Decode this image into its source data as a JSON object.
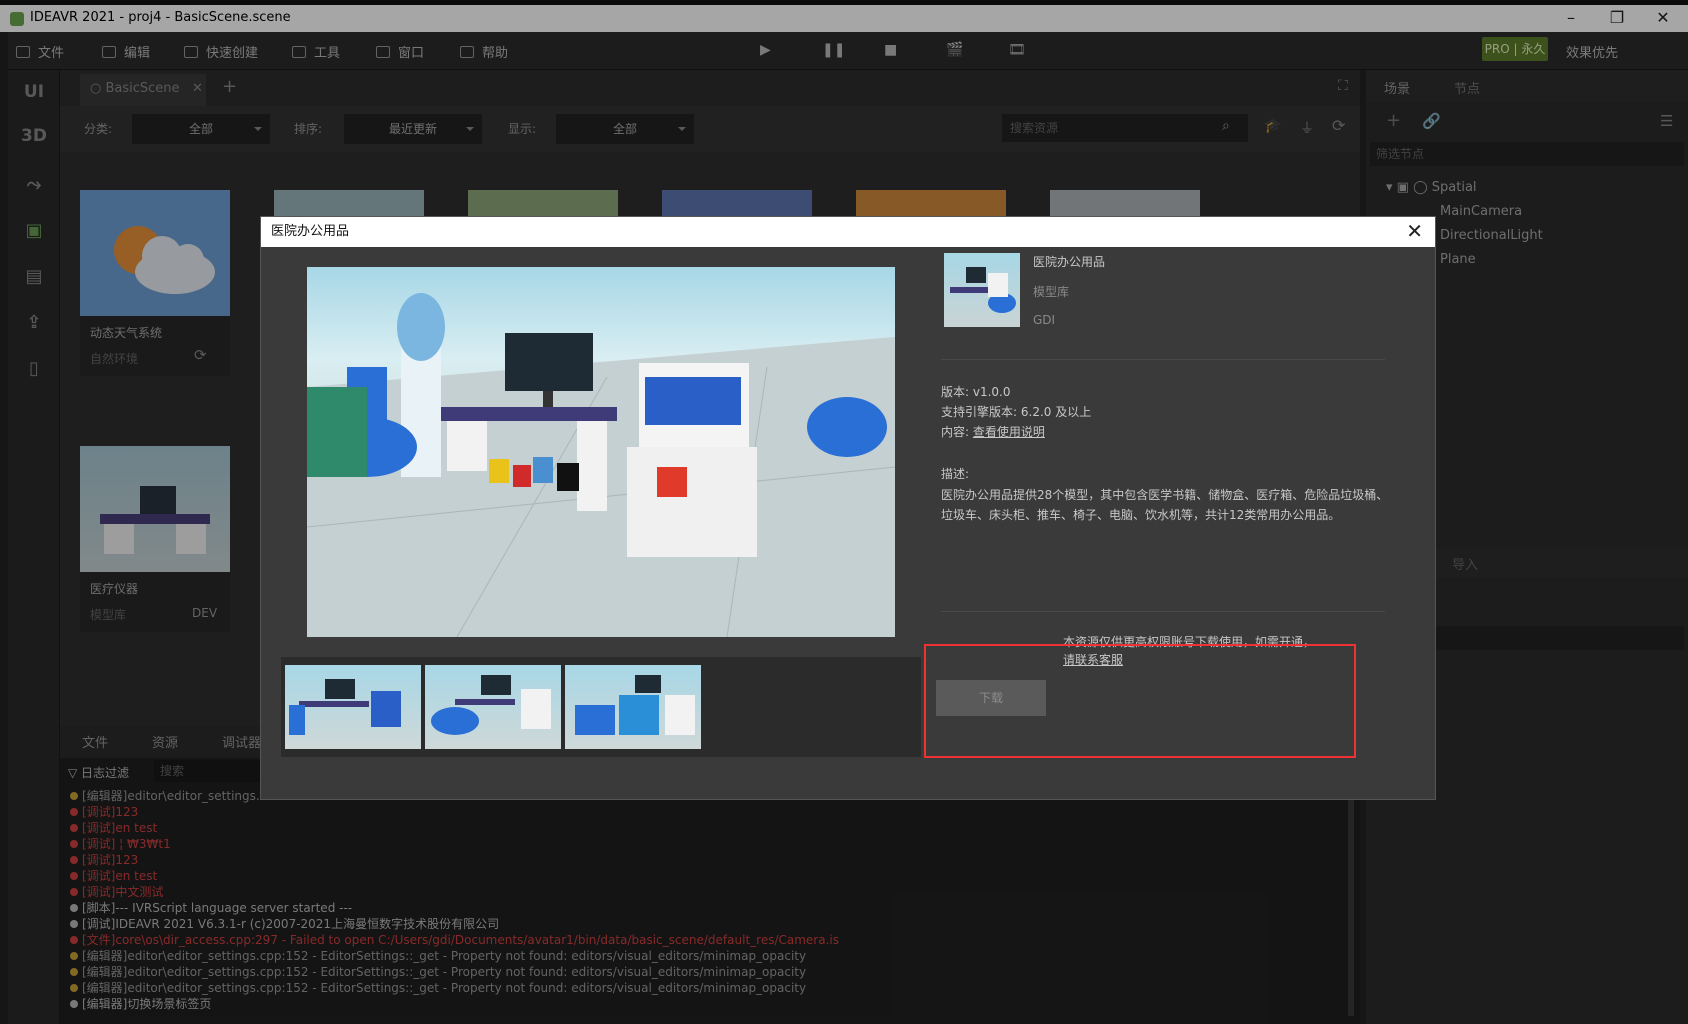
{
  "window": {
    "title": "IDEAVR 2021 - proj4 - BasicScene.scene"
  },
  "menu": [
    "文件",
    "编辑",
    "快速创建",
    "工具",
    "窗口",
    "帮助"
  ],
  "toolbar": {
    "pro_badge": "PRO | 永久",
    "quality": "效果优先"
  },
  "left_bar": {
    "ui": "UI",
    "3d": "3D"
  },
  "scene_tab": {
    "label": "BasicScene"
  },
  "filters": {
    "category_label": "分类:",
    "category_value": "全部",
    "sort_label": "排序:",
    "sort_value": "最近更新",
    "display_label": "显示:",
    "display_value": "全部",
    "search_placeholder": "搜索资源"
  },
  "cards": [
    {
      "name": "动态天气系统",
      "sub": "自然环境"
    },
    {
      "name": "医疗仪器",
      "sub": "模型库",
      "author": "DEV"
    }
  ],
  "right_panel": {
    "tabs": [
      "场景",
      "节点"
    ],
    "filter_placeholder": "筛选节点",
    "nodes": [
      "Spatial",
      "MainCamera",
      "DirectionalLight",
      "Plane"
    ],
    "import_tab": "导入"
  },
  "bottom": {
    "tabs": [
      "文件",
      "资源",
      "调试器"
    ],
    "log_filter": "日志过滤",
    "log_search": "搜索",
    "logs": [
      {
        "c": "#c8a13a",
        "t": "[编辑器]editor\\editor_settings.c"
      },
      {
        "c": "#d04040",
        "t": "[调试]123"
      },
      {
        "c": "#d04040",
        "t": "[调试]en test"
      },
      {
        "c": "#d04040",
        "t": "[调试] ¦ ₩3₩t1"
      },
      {
        "c": "#d04040",
        "t": "[调试]123"
      },
      {
        "c": "#d04040",
        "t": "[调试]en test"
      },
      {
        "c": "#d04040",
        "t": "[调试]中文测试"
      },
      {
        "c": "#bbbbbb",
        "t": "[脚本]--- IVRScript language server started ---"
      },
      {
        "c": "#bbbbbb",
        "t": "[调试]IDEAVR 2021 V6.3.1-r (c)2007-2021上海曼恒数字技术股份有限公司"
      },
      {
        "c": "#d04040",
        "t": "[文件]core\\os\\dir_access.cpp:297 - Failed to open C:/Users/gdi/Documents/avatar1/bin/data/basic_scene/default_res/Camera.is"
      },
      {
        "c": "#c8a13a",
        "t": "[编辑器]editor\\editor_settings.cpp:152 - EditorSettings::_get - Property not found: editors/visual_editors/minimap_opacity"
      },
      {
        "c": "#c8a13a",
        "t": "[编辑器]editor\\editor_settings.cpp:152 - EditorSettings::_get - Property not found: editors/visual_editors/minimap_opacity"
      },
      {
        "c": "#c8a13a",
        "t": "[编辑器]editor\\editor_settings.cpp:152 - EditorSettings::_get - Property not found: editors/visual_editors/minimap_opacity"
      },
      {
        "c": "#bbbbbb",
        "t": "[编辑器]切换场景标签页"
      }
    ]
  },
  "dialog": {
    "title": "医院办公用品",
    "product_name": "医院办公用品",
    "product_category": "模型库",
    "product_author": "GDI",
    "version_label": "版本:",
    "version": "v1.0.0",
    "engine_label": "支持引擎版本:",
    "engine": "6.2.0 及以上",
    "content_label": "内容:",
    "content_link": "查看使用说明",
    "desc_label": "描述:",
    "desc": "医院办公用品提供28个模型，其中包含医学书籍、储物盒、医疗箱、危险品垃圾桶、垃圾车、床头柜、推车、椅子、电脑、饮水机等，共计12类常用办公用品。",
    "download_button": "下载",
    "notice": "本资源仅供更高权限账号下载使用，如需开通，",
    "contact_link": "请联系客服"
  }
}
